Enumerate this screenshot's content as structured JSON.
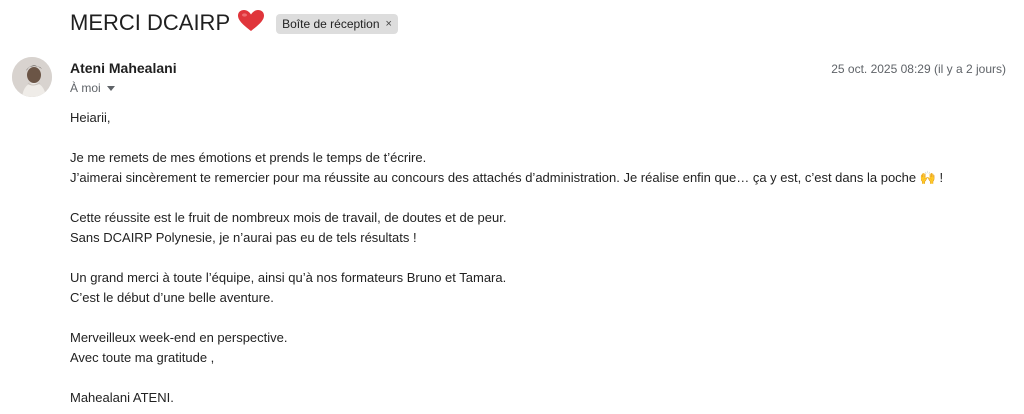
{
  "email": {
    "subject": "MERCI DCAIRP",
    "subject_emoji": "heart-emoji",
    "label": "Boîte de réception",
    "label_remove": "×",
    "sender": "Ateni Mahealani",
    "recipient": "À moi",
    "date": "25 oct. 2025 08:29 (il y a 2 jours)",
    "body": {
      "greeting": "Heiarii,",
      "p1_l1": "Je me remets de mes émotions et prends le temps de t’écrire.",
      "p1_l2": "J’aimerai sincèrement te remercier pour ma réussite au concours des attachés d’administration. Je réalise enfin que… ça y est, c’est dans la poche 🙌 !",
      "p2_l1": "Cette réussite est le fruit de nombreux mois de travail, de doutes et de peur.",
      "p2_l2": "Sans DCAIRP Polynesie, je n’aurai pas eu de tels résultats !",
      "p3_l1": "Un grand merci à toute l’équipe, ainsi qu’à nos formateurs Bruno et Tamara.",
      "p3_l2": "C’est le début d’une belle aventure.",
      "p4_l1": "Merveilleux week-end en perspective.",
      "p4_l2": "Avec toute ma gratitude ,",
      "signature": "Mahealani ATENI."
    }
  },
  "colors": {
    "heart": "#e0353b",
    "chip_bg": "#dddddd",
    "muted": "#5f6368"
  }
}
